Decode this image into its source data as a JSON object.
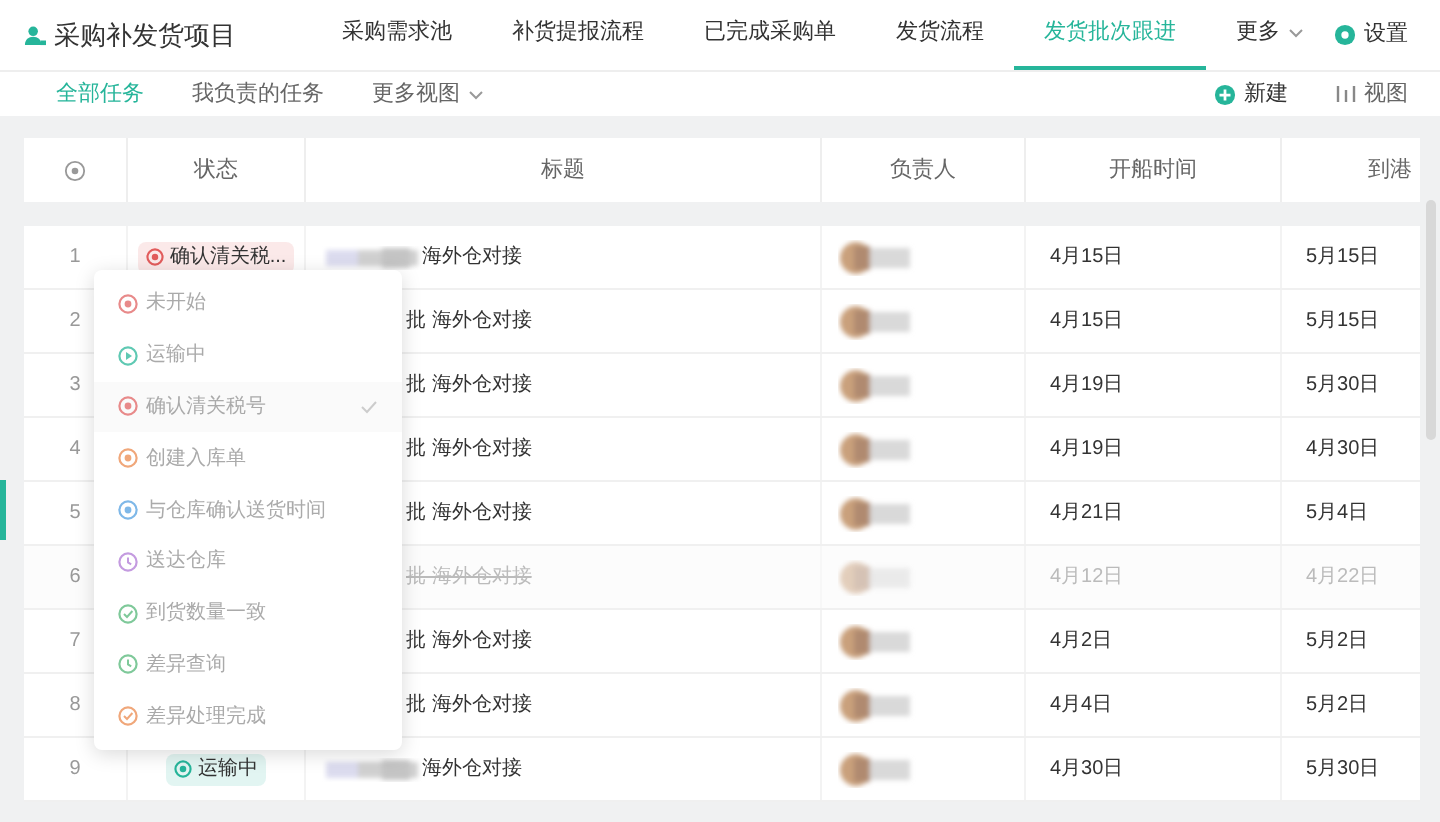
{
  "project": {
    "title": "采购补发货项目"
  },
  "nav_tabs": [
    {
      "label": "采购需求池",
      "selected": false
    },
    {
      "label": "补货提报流程",
      "selected": false
    },
    {
      "label": "已完成采购单",
      "selected": false
    },
    {
      "label": "发货流程",
      "selected": false
    },
    {
      "label": "发货批次跟进",
      "selected": true
    },
    {
      "label": "更多",
      "selected": false,
      "dropdown": true
    }
  ],
  "settings": {
    "label": "设置"
  },
  "view_tabs": [
    {
      "label": "全部任务",
      "selected": true
    },
    {
      "label": "我负责的任务",
      "selected": false
    },
    {
      "label": "更多视图",
      "selected": false,
      "dropdown": true
    }
  ],
  "actions": {
    "new": "新建",
    "view": "视图"
  },
  "table": {
    "columns": [
      "状态",
      "标题",
      "负责人",
      "开船时间",
      "到港"
    ],
    "rows": [
      {
        "index": "1",
        "status": {
          "label": "确认清关税...",
          "color": "#e25c5c"
        },
        "title": "海外仓对接",
        "done": false,
        "ship": "4月15日",
        "arrive": "5月15日"
      },
      {
        "index": "2",
        "title": "批 海外仓对接",
        "done": false,
        "ship": "4月15日",
        "arrive": "5月15日"
      },
      {
        "index": "3",
        "title": "批 海外仓对接",
        "done": false,
        "ship": "4月19日",
        "arrive": "5月30日"
      },
      {
        "index": "4",
        "title": "批 海外仓对接",
        "done": false,
        "ship": "4月19日",
        "arrive": "4月30日"
      },
      {
        "index": "5",
        "title": "批 海外仓对接",
        "done": false,
        "ship": "4月21日",
        "arrive": "5月4日"
      },
      {
        "index": "6",
        "title": "批 海外仓对接",
        "done": true,
        "ship": "4月12日",
        "arrive": "4月22日"
      },
      {
        "index": "7",
        "title": "批 海外仓对接",
        "done": false,
        "ship": "4月2日",
        "arrive": "5月2日"
      },
      {
        "index": "8",
        "title": "批 海外仓对接",
        "done": false,
        "ship": "4月4日",
        "arrive": "5月2日"
      },
      {
        "index": "9",
        "status": {
          "label": "运输中",
          "color": "#26b59a"
        },
        "title": "海外仓对接",
        "done": false,
        "ship": "4月30日",
        "arrive": "5月30日"
      }
    ]
  },
  "status_menu": [
    {
      "label": "未开始",
      "color": "#e88a8a",
      "kind": "dot",
      "selected": false
    },
    {
      "label": "运输中",
      "color": "#5fc9b3",
      "kind": "play",
      "selected": false
    },
    {
      "label": "确认清关税号",
      "color": "#e88a8a",
      "kind": "dot",
      "selected": true
    },
    {
      "label": "创建入库单",
      "color": "#f0a77a",
      "kind": "dot",
      "selected": false
    },
    {
      "label": "与仓库确认送货时间",
      "color": "#7fb8e8",
      "kind": "dot",
      "selected": false
    },
    {
      "label": "送达仓库",
      "color": "#c49be0",
      "kind": "clock",
      "selected": false
    },
    {
      "label": "到货数量一致",
      "color": "#7fc99a",
      "kind": "check",
      "selected": false
    },
    {
      "label": "差异查询",
      "color": "#7fc99a",
      "kind": "clock",
      "selected": false
    },
    {
      "label": "差异处理完成",
      "color": "#f0a77a",
      "kind": "check",
      "selected": false
    }
  ]
}
